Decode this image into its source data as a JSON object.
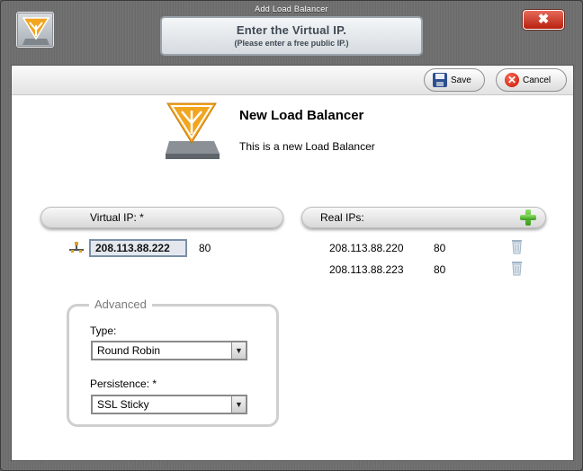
{
  "window": {
    "title": "Add Load Balancer",
    "prompt_title": "Enter the Virtual IP.",
    "prompt_subtitle": "(Please enter a free public IP.)",
    "close_glyph": "✖",
    "icon": "load-balancer-icon"
  },
  "toolbar": {
    "save_label": "Save",
    "cancel_label": "Cancel",
    "save_icon": "floppy-disk-icon",
    "cancel_icon": "cancel-icon",
    "cancel_glyph": "✕"
  },
  "header": {
    "title": "New Load Balancer",
    "description": "This is a new Load Balancer"
  },
  "virtual_ip": {
    "label": "Virtual IP:  *",
    "value": "208.113.88.222",
    "port": "80"
  },
  "real_ips": {
    "label": "Real IPs:",
    "rows": [
      {
        "ip": "208.113.88.220",
        "port": "80"
      },
      {
        "ip": "208.113.88.223",
        "port": "80"
      }
    ]
  },
  "advanced": {
    "legend": "Advanced",
    "type_label": "Type:",
    "type_value": "Round Robin",
    "persistence_label": "Persistence:  *",
    "persistence_value": "SSL Sticky",
    "arrow_glyph": "▼"
  },
  "colors": {
    "accent_orange": "#f0a020",
    "close_red": "#c92a16",
    "add_green": "#4caf2a"
  }
}
